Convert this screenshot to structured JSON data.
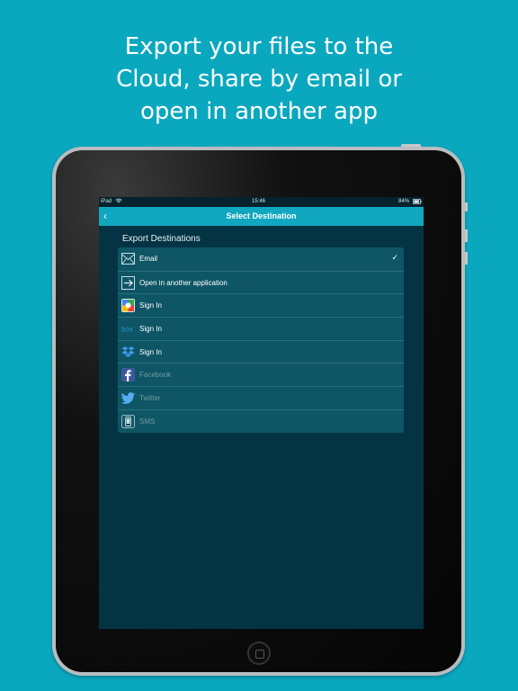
{
  "headline": {
    "line1": "Export your files to the",
    "line2": "Cloud, share by email or",
    "line3": "open in another app"
  },
  "status_bar": {
    "carrier": "iPad",
    "time": "15:46",
    "battery": "84%"
  },
  "nav": {
    "title": "Select Destination",
    "back_icon": "chevron-left-icon"
  },
  "section_title": "Export Destinations",
  "destinations": [
    {
      "label": "Email",
      "icon": "envelope-icon",
      "checked": true,
      "enabled": true
    },
    {
      "label": "Open in another application",
      "icon": "open-in-icon",
      "checked": false,
      "enabled": true
    },
    {
      "label": "Sign In",
      "icon": "google-drive-icon",
      "checked": false,
      "enabled": true
    },
    {
      "label": "Sign In",
      "icon": "box-icon",
      "checked": false,
      "enabled": true
    },
    {
      "label": "Sign In",
      "icon": "dropbox-icon",
      "checked": false,
      "enabled": true
    },
    {
      "label": "Facebook",
      "icon": "facebook-icon",
      "checked": false,
      "enabled": false
    },
    {
      "label": "Twitter",
      "icon": "twitter-icon",
      "checked": false,
      "enabled": false
    },
    {
      "label": "SMS",
      "icon": "phone-icon",
      "checked": false,
      "enabled": false
    }
  ],
  "checkmark": "✓",
  "colors": {
    "background": "#0aa8bf",
    "navbar": "#12a7c0",
    "screen": "#043444",
    "list": "#0e5666"
  }
}
